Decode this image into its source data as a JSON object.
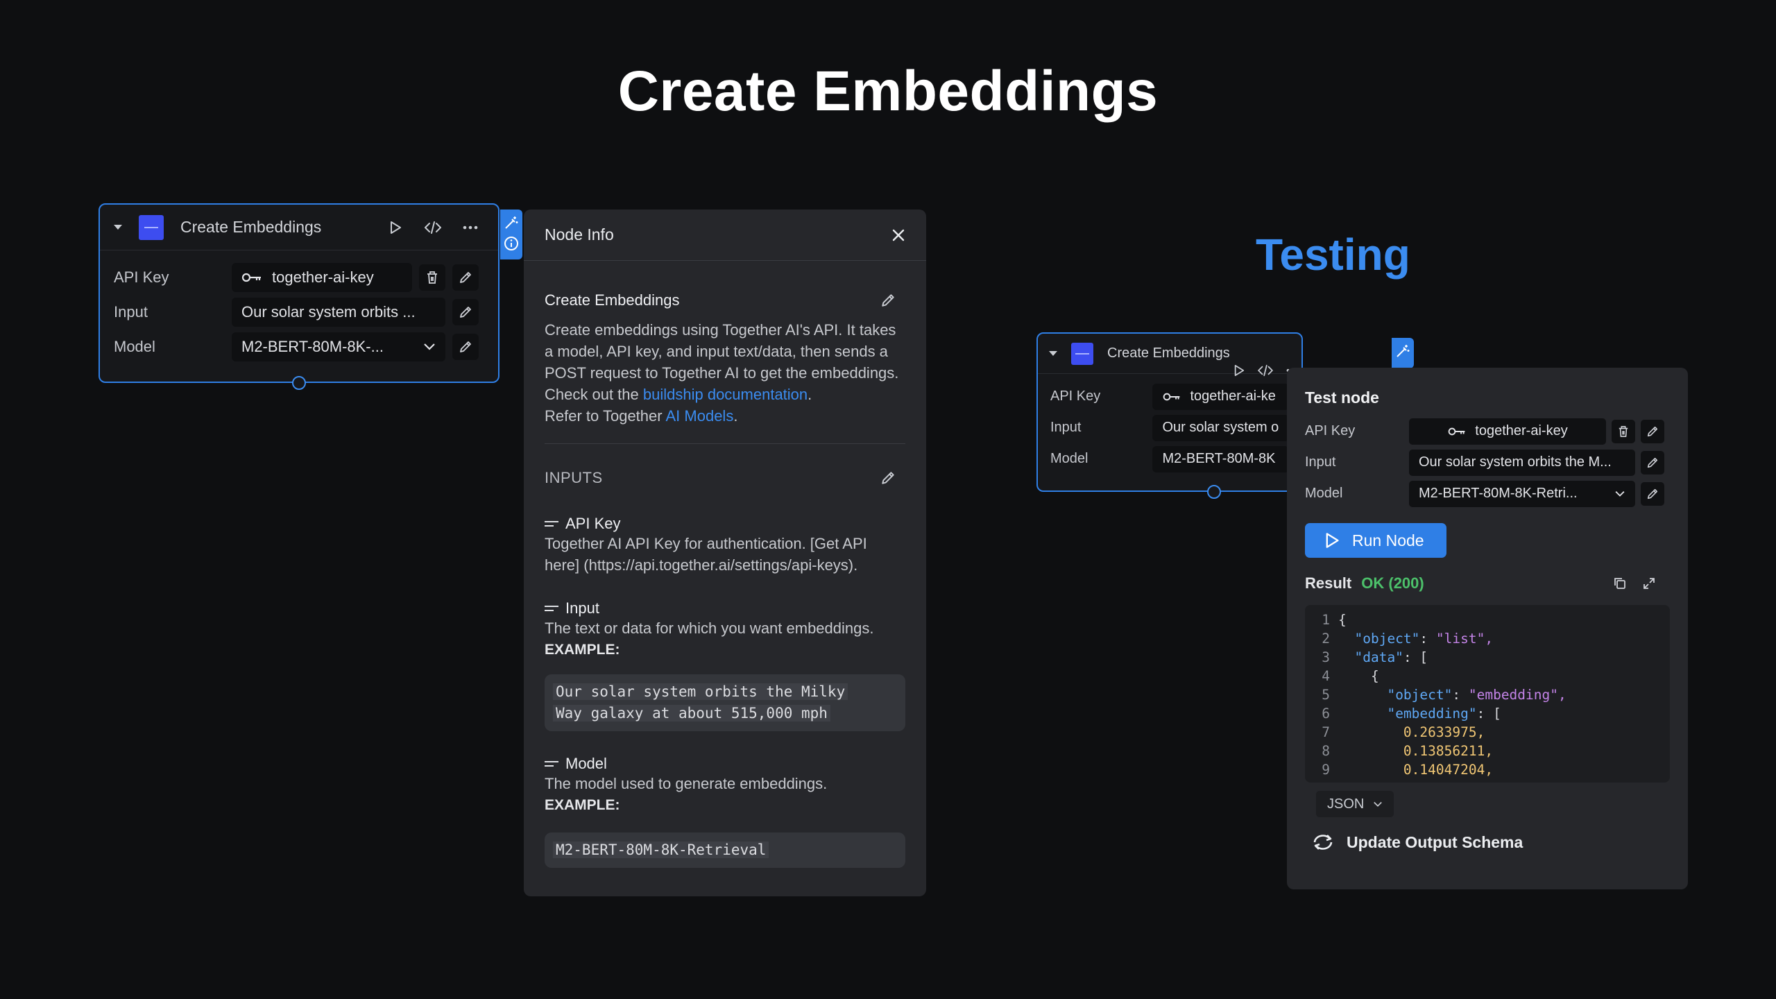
{
  "page": {
    "title": "Create Embeddings",
    "testing_label": "Testing"
  },
  "node": {
    "title": "Create Embeddings",
    "fields": [
      {
        "label": "API Key",
        "value": "together-ai-key"
      },
      {
        "label": "Input",
        "value": "Our solar system orbits ..."
      },
      {
        "label": "Model",
        "value": "M2-BERT-80M-8K-..."
      }
    ]
  },
  "info_panel": {
    "title": "Node Info",
    "section_title": "Create Embeddings",
    "description": "Create embeddings using Together AI's API. It takes a model, API key, and input text/data, then sends a POST request to Together AI to get the embeddings.",
    "docs_prefix": "Check out the ",
    "docs_link": "buildship documentation",
    "docs_suffix": ".",
    "models_prefix": "Refer to Together ",
    "models_link": "AI Models",
    "models_suffix": ".",
    "inputs_title": "INPUTS",
    "params": [
      {
        "name": "API Key",
        "desc": "Together AI API Key for authentication. [Get API here] (https://api.together.ai/settings/api-keys)."
      },
      {
        "name": "Input",
        "desc": "The text or data for which you want embeddings.",
        "example_label": "EXAMPLE:",
        "example_line1": "Our solar system orbits the Milky",
        "example_line2": "Way galaxy at about 515,000 mph"
      },
      {
        "name": "Model",
        "desc": "The model used to generate embeddings.",
        "example_label": "EXAMPLE:",
        "example_line1": "M2-BERT-80M-8K-Retrieval"
      }
    ]
  },
  "test_node_card": {
    "title": "Create Embeddings",
    "fields": [
      {
        "label": "API Key",
        "value": "together-ai-ke"
      },
      {
        "label": "Input",
        "value": "Our solar system o"
      },
      {
        "label": "Model",
        "value": "M2-BERT-80M-8K"
      }
    ]
  },
  "test_panel": {
    "title": "Test node",
    "fields": [
      {
        "label": "API Key",
        "value": "together-ai-key"
      },
      {
        "label": "Input",
        "value": "Our solar system orbits the M..."
      },
      {
        "label": "Model",
        "value": "M2-BERT-80M-8K-Retri..."
      }
    ],
    "run_label": "Run Node",
    "result_label": "Result",
    "status": "OK (200)",
    "code_lines": [
      {
        "n": "1",
        "ind": "",
        "key": "",
        "sep": "",
        "val": "{",
        "cls": "p"
      },
      {
        "n": "2",
        "ind": "  ",
        "key": "\"object\"",
        "sep": ": ",
        "val": "\"list\",",
        "cls": "s"
      },
      {
        "n": "3",
        "ind": "  ",
        "key": "\"data\"",
        "sep": ": ",
        "val": "[",
        "cls": "p"
      },
      {
        "n": "4",
        "ind": "    ",
        "key": "",
        "sep": "",
        "val": "{",
        "cls": "p"
      },
      {
        "n": "5",
        "ind": "      ",
        "key": "\"object\"",
        "sep": ": ",
        "val": "\"embedding\",",
        "cls": "s"
      },
      {
        "n": "6",
        "ind": "      ",
        "key": "\"embedding\"",
        "sep": ": ",
        "val": "[",
        "cls": "p"
      },
      {
        "n": "7",
        "ind": "        ",
        "key": "",
        "sep": "",
        "val": "0.2633975,",
        "cls": "n"
      },
      {
        "n": "8",
        "ind": "        ",
        "key": "",
        "sep": "",
        "val": "0.13856211,",
        "cls": "n"
      },
      {
        "n": "9",
        "ind": "        ",
        "key": "",
        "sep": "",
        "val": "0.14047204,",
        "cls": "n"
      }
    ],
    "format": "JSON",
    "update_label": "Update Output Schema"
  },
  "colors": {
    "accent": "#2f7fe6",
    "ok": "#4cc06a",
    "background": "#0e0f11",
    "panel": "#26272b"
  }
}
